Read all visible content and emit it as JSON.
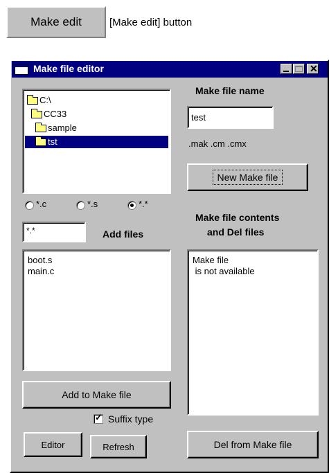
{
  "top": {
    "make_edit_button": "Make edit",
    "caption": "[Make edit] button"
  },
  "window": {
    "title": "Make file editor"
  },
  "tree": {
    "items": [
      {
        "label": "C:\\"
      },
      {
        "label": "CC33"
      },
      {
        "label": "sample"
      },
      {
        "label": "tst",
        "selected": true
      }
    ]
  },
  "filters": {
    "options": [
      "*.c",
      "*.s",
      "*.*"
    ],
    "selected": "*.*"
  },
  "filter_input": {
    "value": "*.*"
  },
  "add_files_label": "Add files",
  "files_list": [
    "boot.s",
    "main.c"
  ],
  "make_file_name": {
    "label": "Make file name",
    "value": "test",
    "extensions": ".mak .cm .cmx"
  },
  "buttons": {
    "new_make_file": "New Make file",
    "add_to_make_file": "Add to Make file",
    "editor": "Editor",
    "refresh": "Refresh",
    "del_from_make_file": "Del from Make file"
  },
  "suffix_type": {
    "label": "Suffix type",
    "checked": true
  },
  "contents": {
    "label_line1": "Make file contents",
    "label_line2": "and Del files",
    "lines": [
      "Make file",
      " is not available"
    ]
  },
  "colors": {
    "title_bar": "#000080",
    "face": "#c0c0c0",
    "selection": "#000080"
  }
}
